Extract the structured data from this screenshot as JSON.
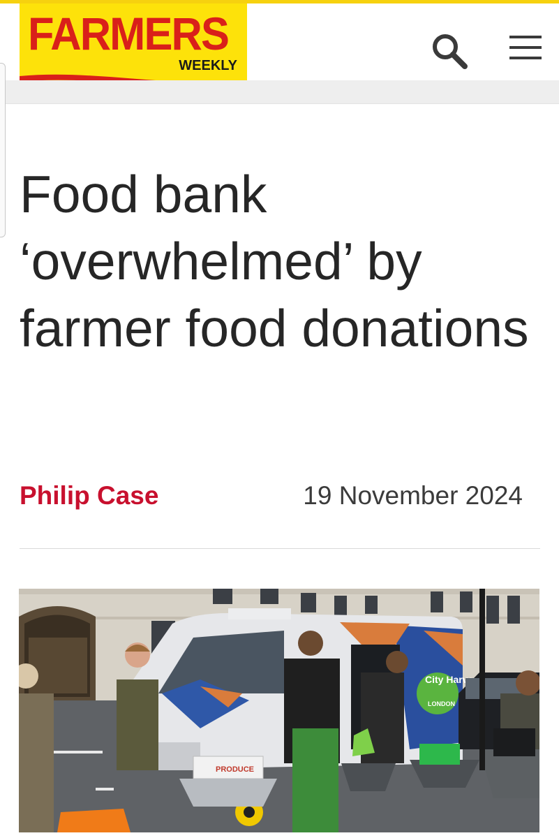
{
  "header": {
    "logo_main": "FARMERS",
    "logo_sub": "WEEKLY",
    "search_icon": "search-icon",
    "menu_icon": "hamburger-menu-icon"
  },
  "colors": {
    "brand_yellow": "#fde20a",
    "brand_red": "#d9201a",
    "author_red": "#c8102e"
  },
  "article": {
    "headline": "Food bank ‘overwhelmed’ by farmer food donations",
    "author": "Philip Case",
    "date": "19 November 2024"
  },
  "photo": {
    "van_brand": "City Harvest",
    "van_city": "LONDON",
    "box_label": "PRODUCE"
  }
}
